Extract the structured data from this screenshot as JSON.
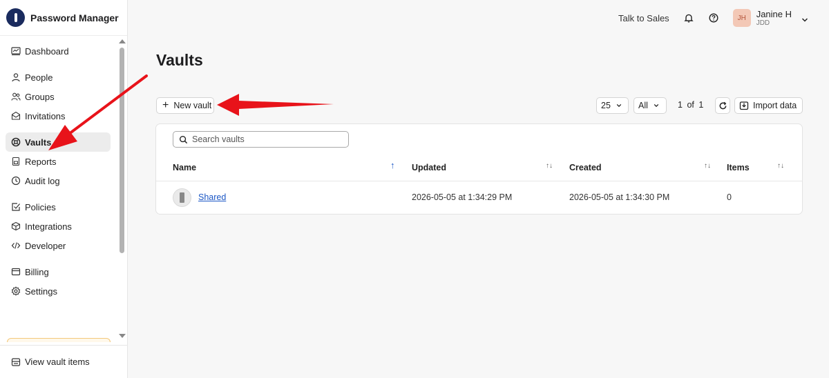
{
  "app": {
    "name": "Password Manager"
  },
  "sidebar": {
    "items": [
      {
        "label": "Dashboard",
        "icon": "dashboard-icon"
      },
      {
        "label": "People",
        "icon": "person-icon"
      },
      {
        "label": "Groups",
        "icon": "groups-icon"
      },
      {
        "label": "Invitations",
        "icon": "envelope-icon"
      },
      {
        "label": "Vaults",
        "icon": "vault-icon",
        "active": true
      },
      {
        "label": "Reports",
        "icon": "report-icon"
      },
      {
        "label": "Audit log",
        "icon": "history-icon"
      },
      {
        "label": "Policies",
        "icon": "checkbox-icon"
      },
      {
        "label": "Integrations",
        "icon": "cube-icon"
      },
      {
        "label": "Developer",
        "icon": "code-icon"
      },
      {
        "label": "Billing",
        "icon": "card-icon"
      },
      {
        "label": "Settings",
        "icon": "gear-icon"
      }
    ],
    "footer": {
      "label": "View vault items",
      "icon": "vault-items-icon"
    }
  },
  "topbar": {
    "talk_to_sales": "Talk to Sales",
    "user": {
      "initials": "JH",
      "name": "Janine H",
      "org": "JDD"
    }
  },
  "main": {
    "title": "Vaults",
    "new_vault_label": "New vault",
    "page_size": "25",
    "filter": "All",
    "pagination": {
      "current": "1",
      "of": "of",
      "total": "1"
    },
    "import_label": "Import data",
    "search_placeholder": "Search vaults",
    "columns": {
      "name": "Name",
      "updated": "Updated",
      "created": "Created",
      "items": "Items"
    },
    "sort_asc_glyph": "↑",
    "sort_glyph": "↑↓",
    "rows": [
      {
        "name": "Shared",
        "updated": "2026-05-05 at 1:34:29 PM",
        "created": "2026-05-05 at 1:34:30 PM",
        "items": "0"
      }
    ]
  },
  "colors": {
    "accent": "#1a56c5",
    "brand": "#1a2b5e",
    "annotation": "#e8131a"
  }
}
